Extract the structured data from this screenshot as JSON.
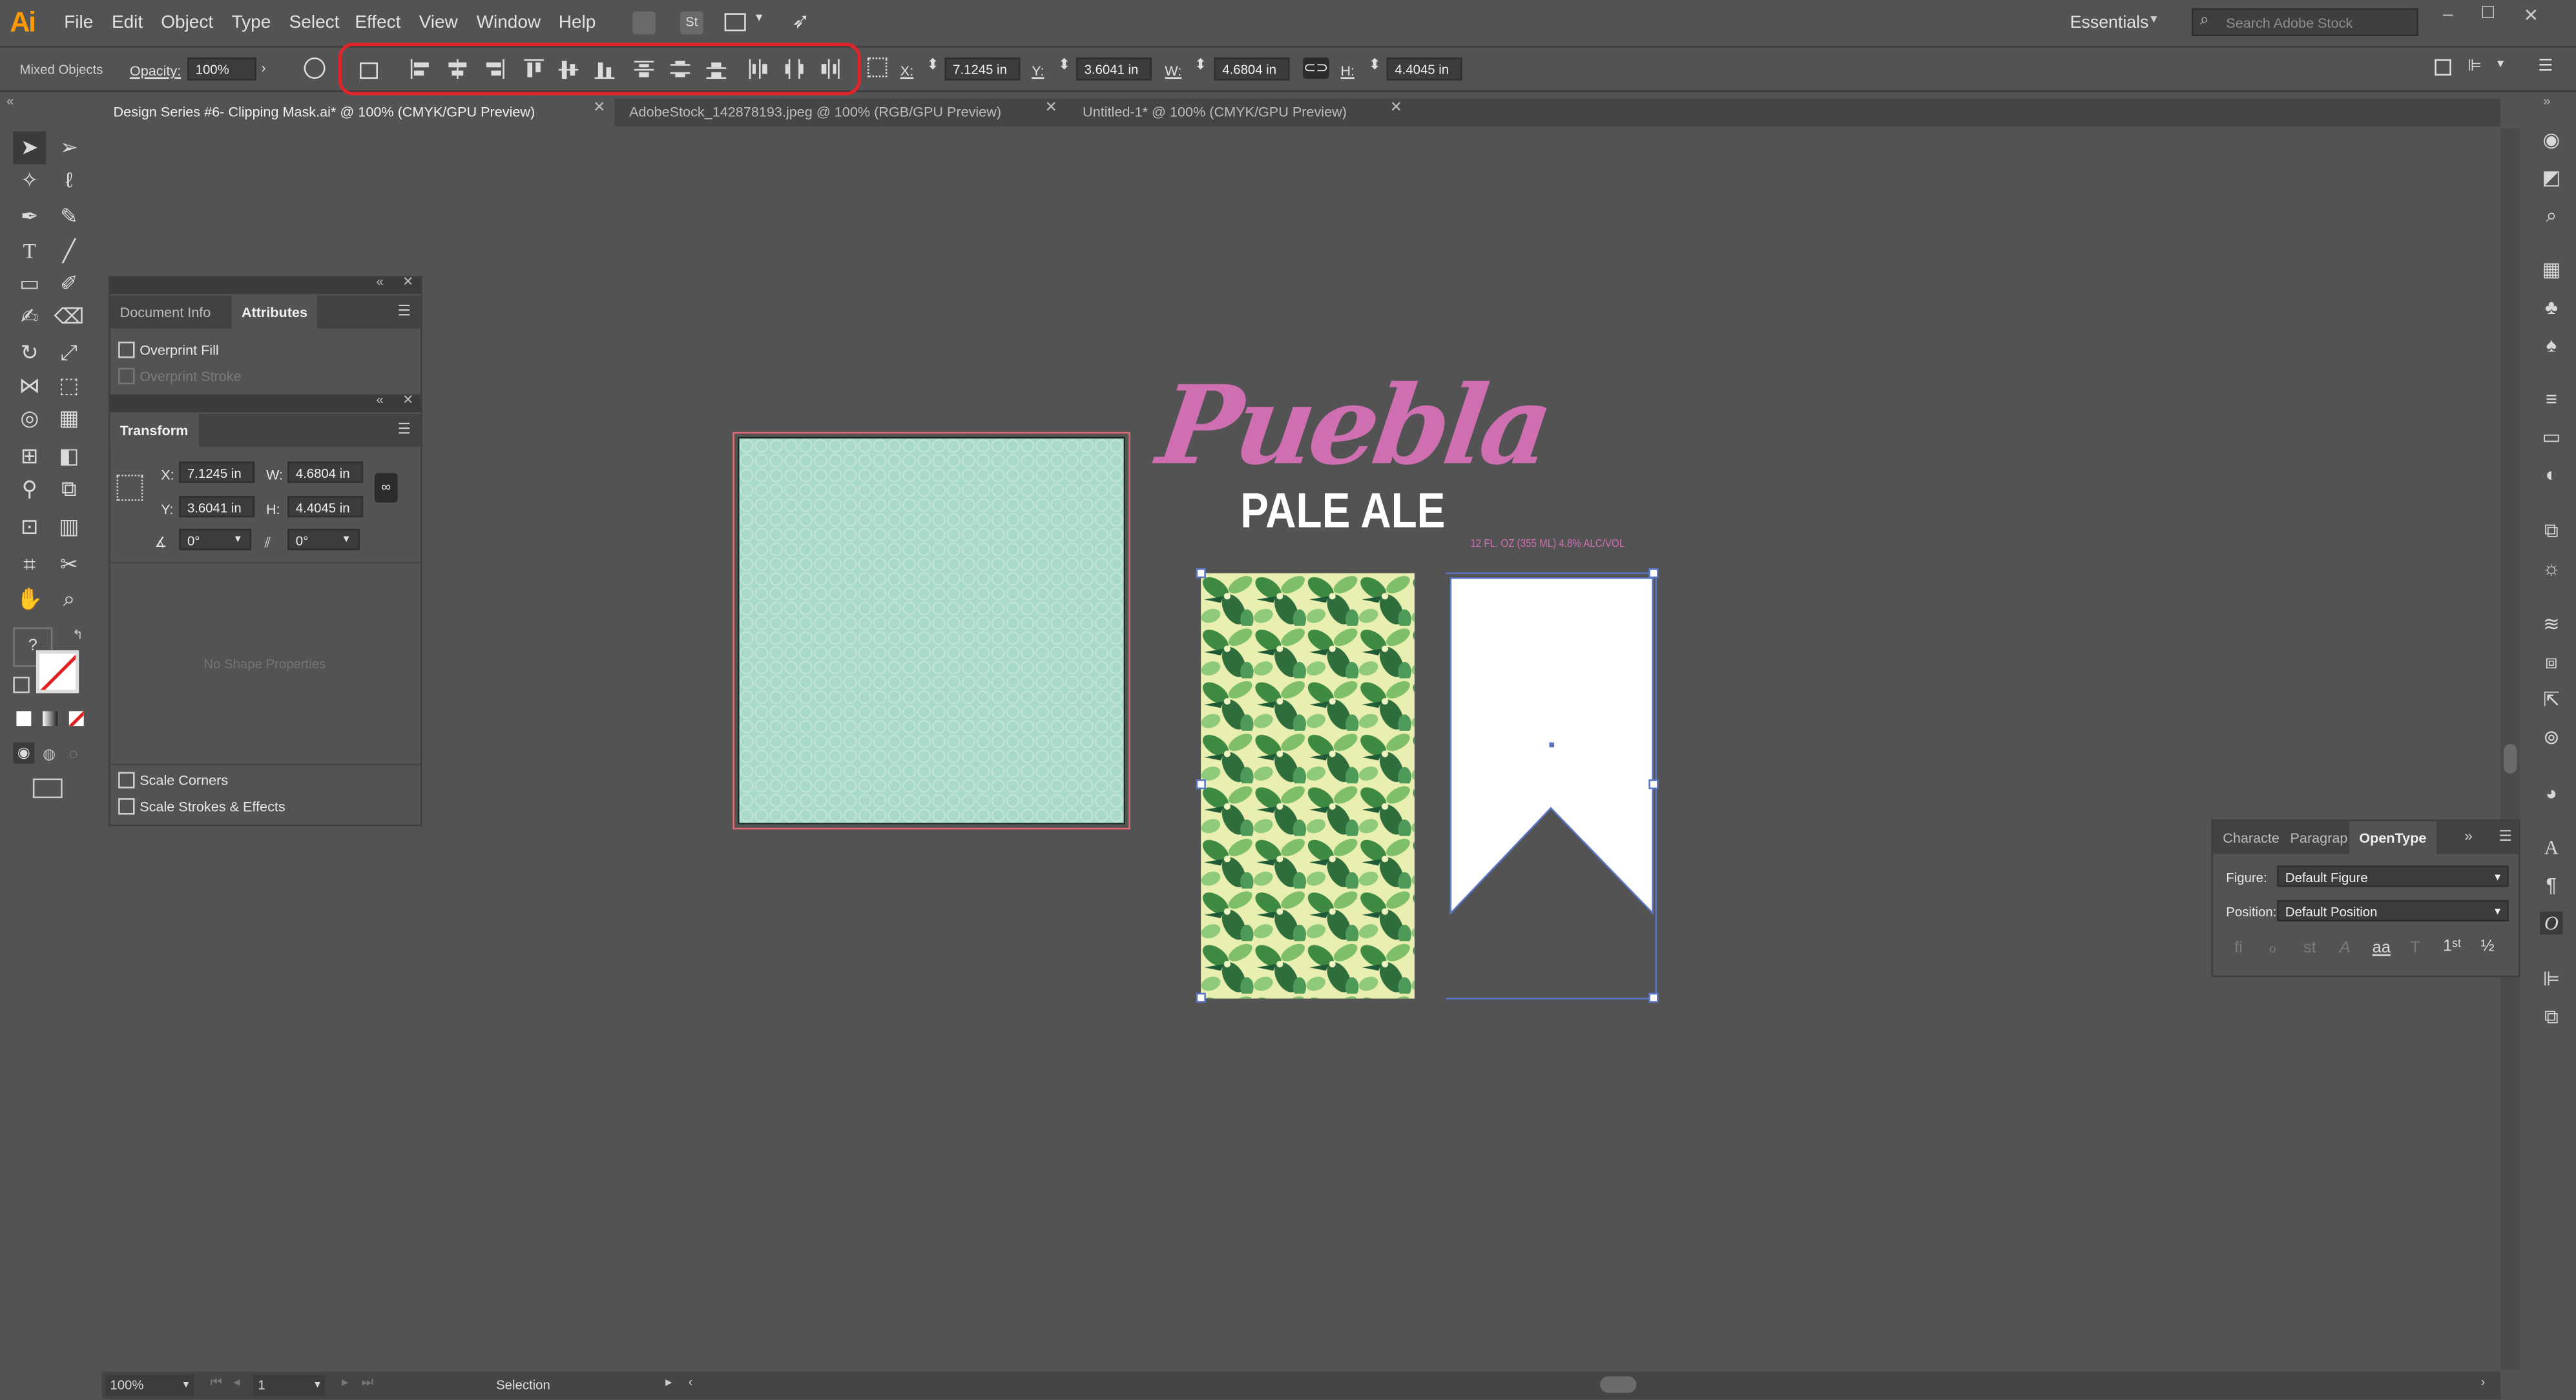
{
  "app": {
    "logo": "Ai",
    "menu": [
      "File",
      "Edit",
      "Object",
      "Type",
      "Select",
      "Effect",
      "View",
      "Window",
      "Help"
    ],
    "workspace": "Essentials",
    "search_placeholder": "Search Adobe Stock"
  },
  "control_bar": {
    "selection_label": "Mixed Objects",
    "opacity_label": "Opacity:",
    "opacity_value": "100%",
    "x_label": "X:",
    "x_value": "7.1245 in",
    "y_label": "Y:",
    "y_value": "3.6041 in",
    "w_label": "W:",
    "w_value": "4.6804 in",
    "h_label": "H:",
    "h_value": "4.4045 in"
  },
  "tabs": [
    {
      "label": "Design Series #6- Clipping Mask.ai* @ 100% (CMYK/GPU Preview)",
      "active": true
    },
    {
      "label": "AdobeStock_142878193.jpeg @ 100% (RGB/GPU Preview)",
      "active": false
    },
    {
      "label": "Untitled-1* @ 100% (CMYK/GPU Preview)",
      "active": false
    }
  ],
  "attributes_panel": {
    "tabs": [
      "Document Info",
      "Attributes"
    ],
    "overprint_fill": "Overprint Fill",
    "overprint_stroke": "Overprint Stroke"
  },
  "transform_panel": {
    "title": "Transform",
    "x_label": "X:",
    "x_value": "7.1245 in",
    "y_label": "Y:",
    "y_value": "3.6041 in",
    "w_label": "W:",
    "w_value": "4.6804 in",
    "h_label": "H:",
    "h_value": "4.4045 in",
    "angle_value": "0°",
    "shear_value": "0°",
    "no_shape": "No Shape Properties",
    "scale_corners": "Scale Corners",
    "scale_strokes": "Scale Strokes & Effects"
  },
  "artwork": {
    "brand": "Puebla",
    "product": "PALE ALE",
    "volume": "12 FL. OZ (355 ML) 4.8% ALC/VOL",
    "brand_color": "#cf6fb2"
  },
  "opentype_panel": {
    "tabs": [
      "Characte",
      "Paragrap",
      "OpenType"
    ],
    "figure_label": "Figure:",
    "figure_value": "Default Figure",
    "position_label": "Position:",
    "position_value": "Default Position"
  },
  "status_bar": {
    "zoom": "100%",
    "artboard": "1",
    "tool": "Selection"
  },
  "colors": {
    "highlight": "#e0242a",
    "mint": "#a9dac9",
    "ui_bg": "#535353"
  }
}
